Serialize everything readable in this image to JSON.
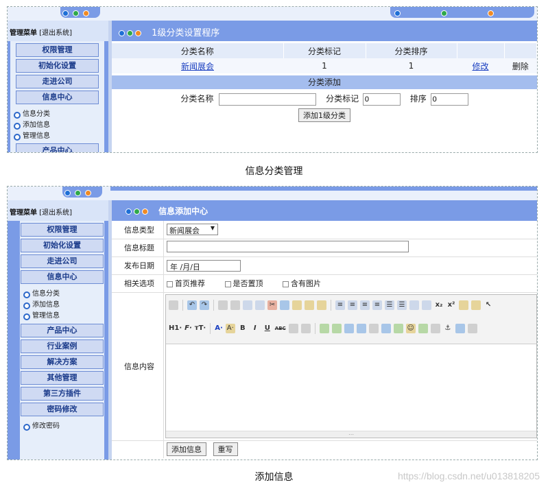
{
  "screen1": {
    "menu_header": {
      "title": "管理菜单",
      "logout": "[退出系统]"
    },
    "menu_buttons": [
      "权限管理",
      "初始化设置",
      "走进公司",
      "信息中心"
    ],
    "menu_sub_items": [
      "信息分类",
      "添加信息",
      "管理信息"
    ],
    "menu_partial_button": "产品中心",
    "title": "1级分类设置程序",
    "table": {
      "headers": [
        "分类名称",
        "分类标记",
        "分类排序",
        "",
        ""
      ],
      "row": {
        "name": "新闻展会",
        "mark": "1",
        "order": "1",
        "edit": "修改",
        "delete": "删除"
      }
    },
    "add_section": {
      "title": "分类添加",
      "name_label": "分类名称",
      "mark_label": "分类标记",
      "mark_value": "0",
      "order_label": "排序",
      "order_value": "0",
      "submit_label": "添加1级分类"
    }
  },
  "caption1": "信息分类管理",
  "screen2": {
    "menu_header": {
      "title": "管理菜单",
      "logout": "[退出系统]"
    },
    "menu_buttons_top": [
      "权限管理",
      "初始化设置",
      "走进公司",
      "信息中心"
    ],
    "menu_sub_items": [
      "信息分类",
      "添加信息",
      "管理信息"
    ],
    "menu_buttons_bottom": [
      "产品中心",
      "行业案例",
      "解决方案",
      "其他管理",
      "第三方插件",
      "密码修改"
    ],
    "menu_bottom_item": "修改密码",
    "title": "信息添加中心",
    "form": {
      "type_label": "信息类型",
      "type_value": "新闻展会",
      "title_label": "信息标题",
      "date_label": "发布日期",
      "date_placeholder": "年 /月/日",
      "options_label": "相关选项",
      "options": [
        "首页推荐",
        "是否置顶",
        "含有图片"
      ],
      "content_label": "信息内容",
      "toolbar_text": {
        "heading": "H1·",
        "font": "F·",
        "size": "тT·",
        "font_color": "A·",
        "bg_color": "A·",
        "bold": "B",
        "italic": "I",
        "underline": "U",
        "strike": "ABC"
      },
      "submit_label": "添加信息",
      "reset_label": "重写"
    }
  },
  "caption2": "添加信息",
  "watermark": "https://blog.csdn.net/u013818205",
  "colors": {
    "accent": "#7a9be6",
    "menu_bg": "#e6eefa",
    "link": "#1a3fc0"
  }
}
